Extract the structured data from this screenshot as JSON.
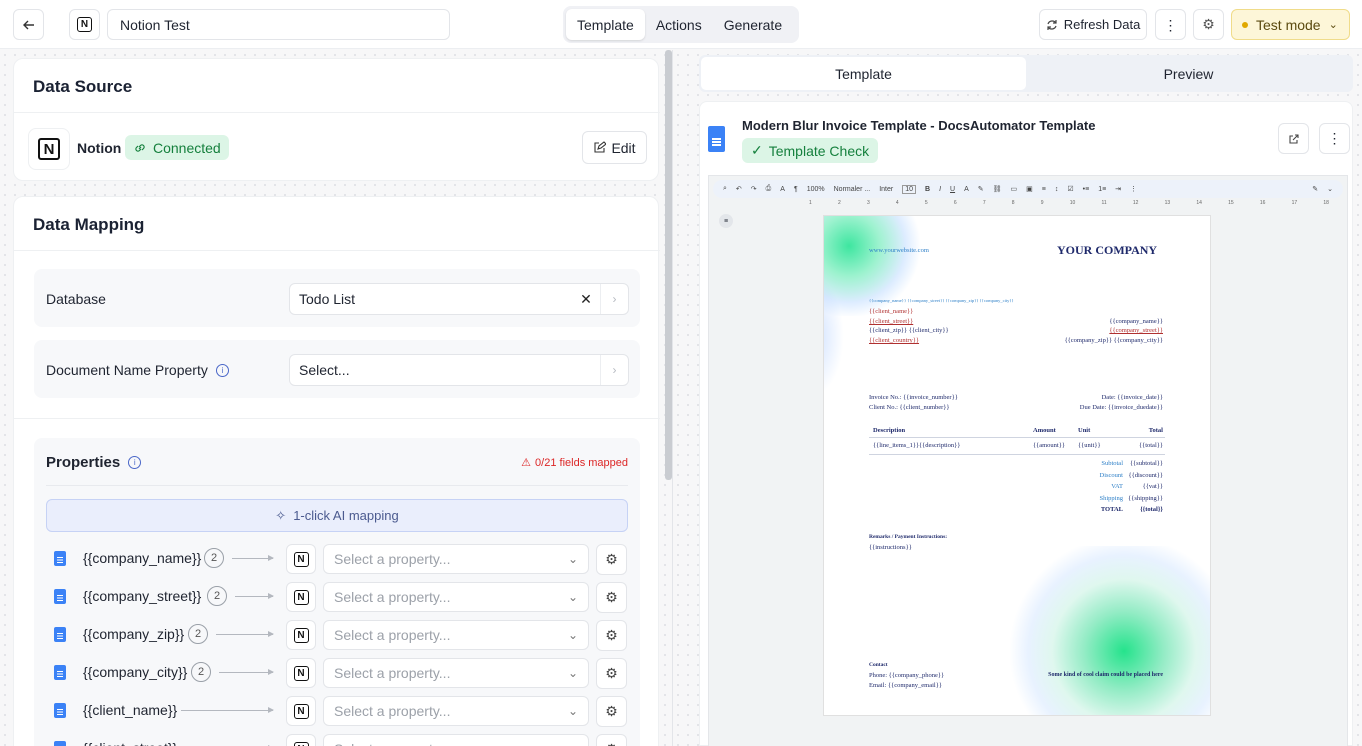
{
  "topbar": {
    "back_icon": "arrow-left-icon",
    "app_icon": "notion-logo",
    "title": "Notion Test",
    "tabs": [
      "Template",
      "Actions",
      "Generate"
    ],
    "active_tab": "Template",
    "refresh_label": "Refresh Data",
    "mode_label": "Test mode",
    "mode_color": "#e0a800"
  },
  "data_source": {
    "heading": "Data Source",
    "provider": "Notion",
    "status": "Connected",
    "status_color": "#15803d",
    "edit_label": "Edit"
  },
  "data_mapping": {
    "heading": "Data Mapping",
    "database_label": "Database",
    "database_value": "Todo List",
    "docname_label": "Document Name Property",
    "docname_placeholder": "Select..."
  },
  "properties": {
    "heading": "Properties",
    "mapped_status": "0/21 fields mapped",
    "ai_button": "1-click AI mapping",
    "select_placeholder": "Select a property...",
    "rows": [
      {
        "name": "{{company_name}}",
        "count": "2"
      },
      {
        "name": "{{company_street}}",
        "count": "2"
      },
      {
        "name": "{{company_zip}}",
        "count": "2"
      },
      {
        "name": "{{company_city}}",
        "count": "2"
      },
      {
        "name": "{{client_name}}",
        "count": ""
      },
      {
        "name": "{{client_street}}",
        "count": ""
      }
    ]
  },
  "right": {
    "tabs": [
      "Template",
      "Preview"
    ],
    "active_tab": "Template",
    "template_name": "Modern Blur Invoice Template - DocsAutomator Template",
    "check_label": "Template Check"
  },
  "gdoc": {
    "toolbar": {
      "zoom": "100%",
      "style": "Normaler ...",
      "font": "Inter",
      "size": "10"
    },
    "ruler": [
      "1",
      "2",
      "3",
      "4",
      "5",
      "6",
      "7",
      "8",
      "9",
      "10",
      "11",
      "12",
      "13",
      "14",
      "15",
      "16",
      "17",
      "18"
    ],
    "website": "www.yourwebsite.com",
    "company": "YOUR COMPANY",
    "company_line": "{{company_name}} {{company_street}} {{company_zip}} {{company_city}}",
    "client": [
      "{{client_name}}",
      "{{client_street}}",
      "{{client_zip}} {{client_city}}",
      "{{client_country}}"
    ],
    "company_right": [
      "{{company_name}}",
      "{{company_street}}",
      "{{company_zip}} {{company_city}}"
    ],
    "invoice_no": "Invoice No.: {{invoice_number}}",
    "client_no": "Client No.: {{client_number}}",
    "date": "Date: {{invoice_date}}",
    "due": "Due Date: {{invoice_duedate}}",
    "table_head": [
      "Description",
      "Amount",
      "Unit",
      "Total"
    ],
    "table_row": [
      "{{line_items_1}}{{description}}",
      "{{amount}}",
      "{{unit}}",
      "{{total}}"
    ],
    "totals": [
      {
        "label": "Subtotal",
        "value": "{{subtotal}}"
      },
      {
        "label": "Discount",
        "value": "{{discount}}"
      },
      {
        "label": "VAT",
        "value": "{{vat}}"
      },
      {
        "label": "Shipping",
        "value": "{{shipping}}"
      },
      {
        "label": "TOTAL",
        "value": "{{total}}"
      }
    ],
    "remarks_title": "Remarks / Payment Instructions:",
    "remarks": "{{instructions}}",
    "contact_title": "Contact",
    "phone": "Phone: {{company_phone}}",
    "email": "Email: {{company_email}}",
    "claim": "Some kind of cool claim could be placed here"
  }
}
